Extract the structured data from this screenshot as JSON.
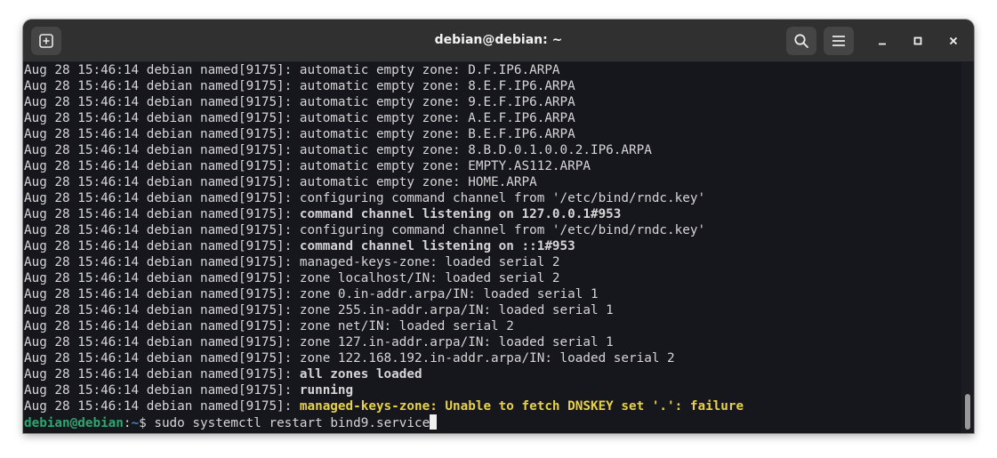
{
  "window": {
    "title": "debian@debian: ~"
  },
  "header_buttons": {
    "new_tab_icon": "new-tab-icon",
    "search_icon": "search-icon",
    "menu_icon": "hamburger-menu-icon",
    "minimize_icon": "minimize-icon",
    "maximize_icon": "maximize-icon",
    "close_icon": "close-icon"
  },
  "terminal": {
    "lines": [
      {
        "prefix": "Aug 28 15:46:14 debian named[9175]: ",
        "message": "automatic empty zone: D.F.IP6.ARPA",
        "style": "normal"
      },
      {
        "prefix": "Aug 28 15:46:14 debian named[9175]: ",
        "message": "automatic empty zone: 8.E.F.IP6.ARPA",
        "style": "normal"
      },
      {
        "prefix": "Aug 28 15:46:14 debian named[9175]: ",
        "message": "automatic empty zone: 9.E.F.IP6.ARPA",
        "style": "normal"
      },
      {
        "prefix": "Aug 28 15:46:14 debian named[9175]: ",
        "message": "automatic empty zone: A.E.F.IP6.ARPA",
        "style": "normal"
      },
      {
        "prefix": "Aug 28 15:46:14 debian named[9175]: ",
        "message": "automatic empty zone: B.E.F.IP6.ARPA",
        "style": "normal"
      },
      {
        "prefix": "Aug 28 15:46:14 debian named[9175]: ",
        "message": "automatic empty zone: 8.B.D.0.1.0.0.2.IP6.ARPA",
        "style": "normal"
      },
      {
        "prefix": "Aug 28 15:46:14 debian named[9175]: ",
        "message": "automatic empty zone: EMPTY.AS112.ARPA",
        "style": "normal"
      },
      {
        "prefix": "Aug 28 15:46:14 debian named[9175]: ",
        "message": "automatic empty zone: HOME.ARPA",
        "style": "normal"
      },
      {
        "prefix": "Aug 28 15:46:14 debian named[9175]: ",
        "message": "configuring command channel from '/etc/bind/rndc.key'",
        "style": "normal"
      },
      {
        "prefix": "Aug 28 15:46:14 debian named[9175]: ",
        "message": "command channel listening on 127.0.0.1#953",
        "style": "bold"
      },
      {
        "prefix": "Aug 28 15:46:14 debian named[9175]: ",
        "message": "configuring command channel from '/etc/bind/rndc.key'",
        "style": "normal"
      },
      {
        "prefix": "Aug 28 15:46:14 debian named[9175]: ",
        "message": "command channel listening on ::1#953",
        "style": "bold"
      },
      {
        "prefix": "Aug 28 15:46:14 debian named[9175]: ",
        "message": "managed-keys-zone: loaded serial 2",
        "style": "normal"
      },
      {
        "prefix": "Aug 28 15:46:14 debian named[9175]: ",
        "message": "zone localhost/IN: loaded serial 2",
        "style": "normal"
      },
      {
        "prefix": "Aug 28 15:46:14 debian named[9175]: ",
        "message": "zone 0.in-addr.arpa/IN: loaded serial 1",
        "style": "normal"
      },
      {
        "prefix": "Aug 28 15:46:14 debian named[9175]: ",
        "message": "zone 255.in-addr.arpa/IN: loaded serial 1",
        "style": "normal"
      },
      {
        "prefix": "Aug 28 15:46:14 debian named[9175]: ",
        "message": "zone net/IN: loaded serial 2",
        "style": "normal"
      },
      {
        "prefix": "Aug 28 15:46:14 debian named[9175]: ",
        "message": "zone 127.in-addr.arpa/IN: loaded serial 1",
        "style": "normal"
      },
      {
        "prefix": "Aug 28 15:46:14 debian named[9175]: ",
        "message": "zone 122.168.192.in-addr.arpa/IN: loaded serial 2",
        "style": "normal"
      },
      {
        "prefix": "Aug 28 15:46:14 debian named[9175]: ",
        "message": "all zones loaded",
        "style": "bold"
      },
      {
        "prefix": "Aug 28 15:46:14 debian named[9175]: ",
        "message": "running",
        "style": "bold"
      },
      {
        "prefix": "Aug 28 15:46:14 debian named[9175]: ",
        "message": "managed-keys-zone: Unable to fetch DNSKEY set '.': failure",
        "style": "warn"
      }
    ],
    "prompt": {
      "user_host": "debian@debian",
      "separator": ":",
      "path": "~",
      "symbol": "$ ",
      "command": "sudo systemctl restart bind9.service"
    }
  },
  "colors": {
    "terminal_bg": "#16161d",
    "titlebar_bg": "#303030",
    "prompt_user": "#2ea66f",
    "prompt_path": "#4f7fd1",
    "warning_text": "#e6d24a"
  }
}
